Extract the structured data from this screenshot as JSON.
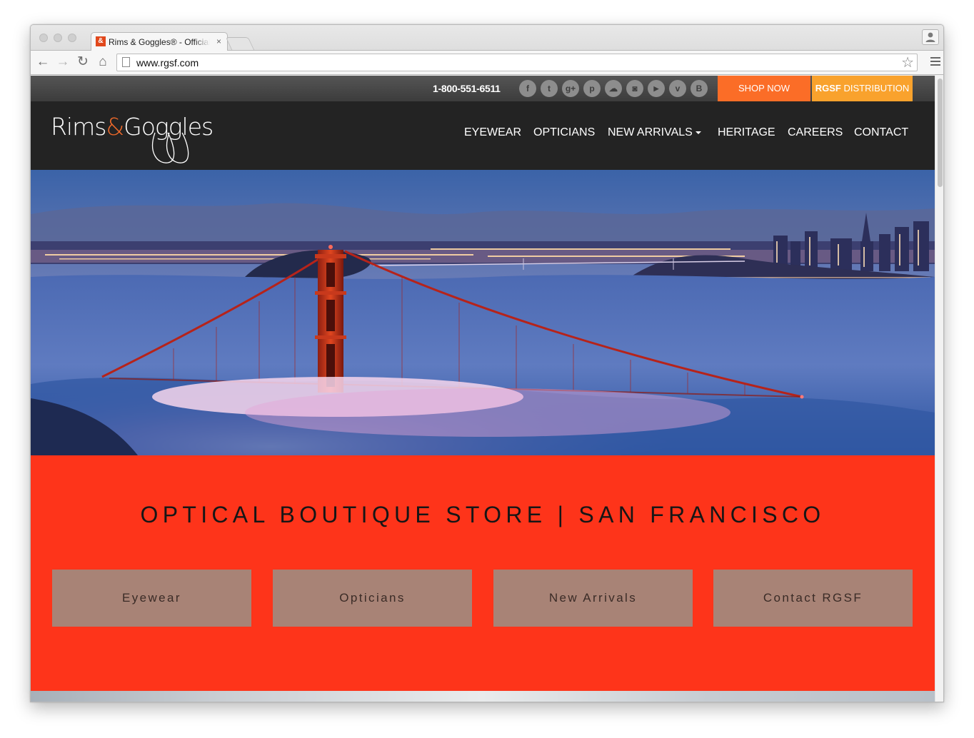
{
  "browser": {
    "tab_title": "Rims & Goggles® - Official Site",
    "tab_favicon": "&",
    "tab_close": "×",
    "url": "www.rgsf.com",
    "icons": {
      "back": "←",
      "forward": "→",
      "reload": "↻",
      "home": "⌂",
      "star": "☆"
    }
  },
  "topbar": {
    "phone": "1-800-551-6511",
    "social": [
      {
        "name": "facebook",
        "glyph": "f"
      },
      {
        "name": "twitter",
        "glyph": "t"
      },
      {
        "name": "google-plus",
        "glyph": "g+"
      },
      {
        "name": "pinterest",
        "glyph": "p"
      },
      {
        "name": "soundcloud",
        "glyph": "☁"
      },
      {
        "name": "instagram",
        "glyph": "◙"
      },
      {
        "name": "youtube",
        "glyph": "▶"
      },
      {
        "name": "vimeo",
        "glyph": "v"
      },
      {
        "name": "blogger",
        "glyph": "B"
      }
    ],
    "shop_now": "SHOP NOW",
    "dist_brand": "RGSF",
    "dist_label": " DISTRIBUTION",
    "shop_color": "#fb6d27",
    "dist_color": "#f9a22d"
  },
  "header": {
    "logo_left": "Rims",
    "logo_amp": "&",
    "logo_right": "Goggles",
    "nav": [
      {
        "label": "EYEWEAR"
      },
      {
        "label": "OPTICIANS"
      },
      {
        "label": "NEW ARRIVALS",
        "dropdown": true
      },
      {
        "label": "HERITAGE"
      },
      {
        "label": "CAREERS"
      },
      {
        "label": "CONTACT"
      }
    ]
  },
  "promo": {
    "title": "OPTICAL BOUTIQUE STORE | SAN FRANCISCO",
    "background": "#fe341a",
    "buttons": [
      {
        "label": "Eyewear"
      },
      {
        "label": "Opticians"
      },
      {
        "label": "New Arrivals"
      },
      {
        "label": "Contact RGSF"
      }
    ]
  }
}
